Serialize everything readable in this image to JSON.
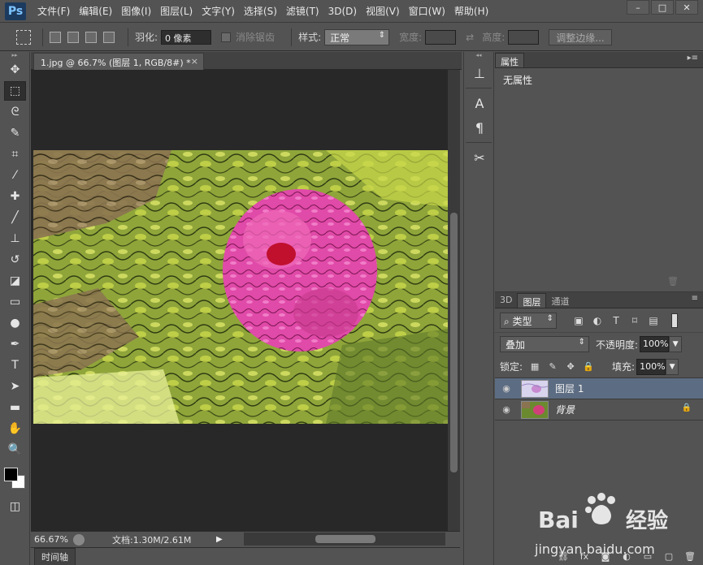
{
  "app": {
    "logo": "Ps"
  },
  "menu": [
    "文件(F)",
    "编辑(E)",
    "图像(I)",
    "图层(L)",
    "文字(Y)",
    "选择(S)",
    "滤镜(T)",
    "3D(D)",
    "视图(V)",
    "窗口(W)",
    "帮助(H)"
  ],
  "window_controls": {
    "minimize": "–",
    "maximize": "□",
    "close": "✕"
  },
  "options": {
    "feather_label": "羽化:",
    "feather_value": "0 像素",
    "antialias_label": "消除锯齿",
    "style_label": "样式:",
    "style_value": "正常",
    "width_label": "宽度:",
    "height_label": "高度:",
    "refine_button": "调整边缘..."
  },
  "document": {
    "tab_title": "1.jpg @ 66.7% (图层 1, RGB/8#) *",
    "tab_close": "×",
    "zoom": "66.67%",
    "doc_info": "文档:1.30M/2.61M",
    "timeline_tab": "时间轴"
  },
  "properties_panel": {
    "tab": "属性",
    "body": "无属性"
  },
  "layers_panel": {
    "tabs": [
      "3D",
      "图层",
      "通道"
    ],
    "active_tab": "图层",
    "kind_filter": "类型",
    "blend_mode": "叠加",
    "opacity_label": "不透明度:",
    "opacity_value": "100%",
    "lock_label": "锁定:",
    "fill_label": "填充:",
    "fill_value": "100%",
    "layers": [
      {
        "name": "图层 1",
        "selected": true,
        "italic": false
      },
      {
        "name": "背景",
        "selected": false,
        "italic": true,
        "locked": true
      }
    ]
  },
  "watermark": {
    "brand": "Baidu经验",
    "url": "jingyan.baidu.com"
  },
  "colors": {
    "selected_layer": "#5c6c82",
    "canvas_bg": "#282828",
    "ui_bg": "#535353"
  }
}
